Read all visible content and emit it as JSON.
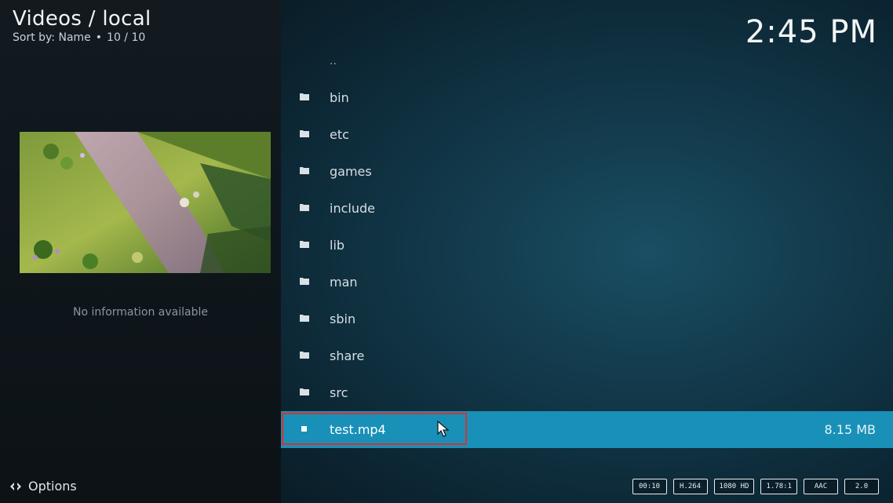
{
  "header": {
    "title": "Videos / local",
    "sort_label": "Sort by: Name",
    "bullet": "•",
    "count": "10 / 10"
  },
  "clock": "2:45 PM",
  "info_panel": {
    "no_info_text": "No information available"
  },
  "options_label": "Options",
  "list": {
    "parent_label": "..",
    "folders": [
      "bin",
      "etc",
      "games",
      "include",
      "lib",
      "man",
      "sbin",
      "share",
      "src"
    ],
    "file": {
      "name": "test.mp4",
      "size": "8.15 MB"
    }
  },
  "badges": [
    "00:10",
    "H.264",
    "1080 HD",
    "1.78:1",
    "AAC",
    "2.0"
  ],
  "colors": {
    "selected_row": "#1990b8",
    "highlight_box": "#d8322f"
  },
  "icons": {
    "folder": "folder-icon",
    "file": "video-file-icon",
    "options": "options-icon",
    "cursor": "mouse-pointer-icon"
  }
}
